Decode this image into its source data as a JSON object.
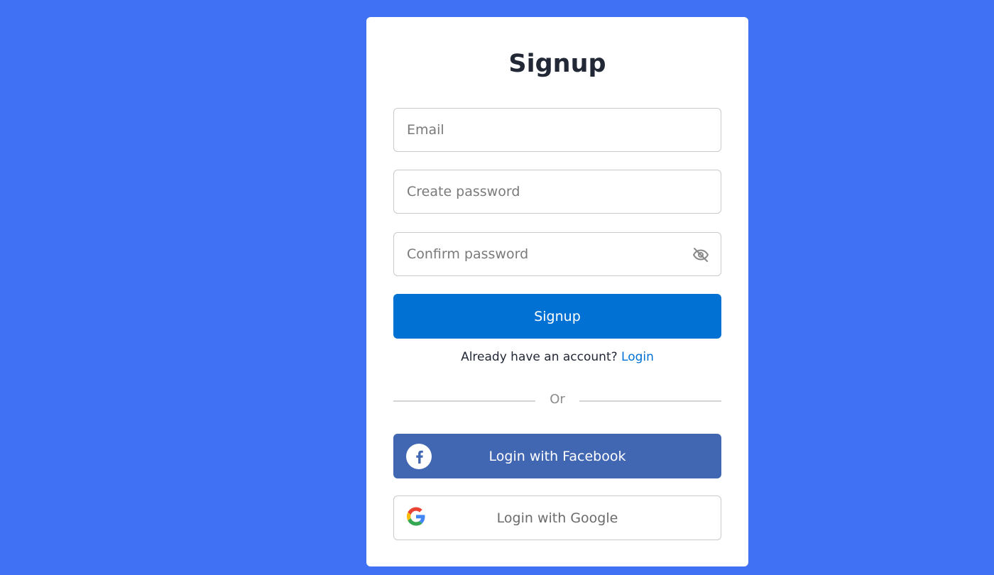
{
  "form": {
    "title": "Signup",
    "email_placeholder": "Email",
    "password_placeholder": "Create password",
    "confirm_placeholder": "Confirm password",
    "submit_label": "Signup",
    "already_text": "Already have an account?",
    "login_link": "Login",
    "divider_text": "Or"
  },
  "social": {
    "facebook_label": "Login with Facebook",
    "google_label": "Login with Google"
  },
  "icons": {
    "password_toggle": "eye-slash-icon",
    "facebook": "facebook-icon",
    "google": "google-icon"
  },
  "colors": {
    "background": "#4070f4",
    "primary": "#0171d3",
    "facebook": "#4267b2"
  }
}
